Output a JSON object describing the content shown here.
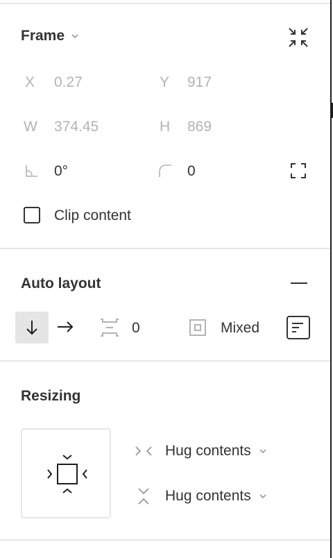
{
  "frame": {
    "title": "Frame",
    "x_label": "X",
    "x_value": "0.27",
    "y_label": "Y",
    "y_value": "917",
    "w_label": "W",
    "w_value": "374.45",
    "h_label": "H",
    "h_value": "869",
    "rotation_value": "0°",
    "radius_value": "0",
    "clip_label": "Clip content",
    "clip_checked": false
  },
  "auto_layout": {
    "title": "Auto layout",
    "direction": "vertical",
    "spacing_value": "0",
    "padding_value": "Mixed"
  },
  "resizing": {
    "title": "Resizing",
    "horizontal_label": "Hug contents",
    "vertical_label": "Hug contents"
  },
  "colors": {
    "text": "#333333",
    "dim": "#b3b3b3",
    "divider": "#e6e6e6",
    "active_bg": "#e5e5e5"
  }
}
